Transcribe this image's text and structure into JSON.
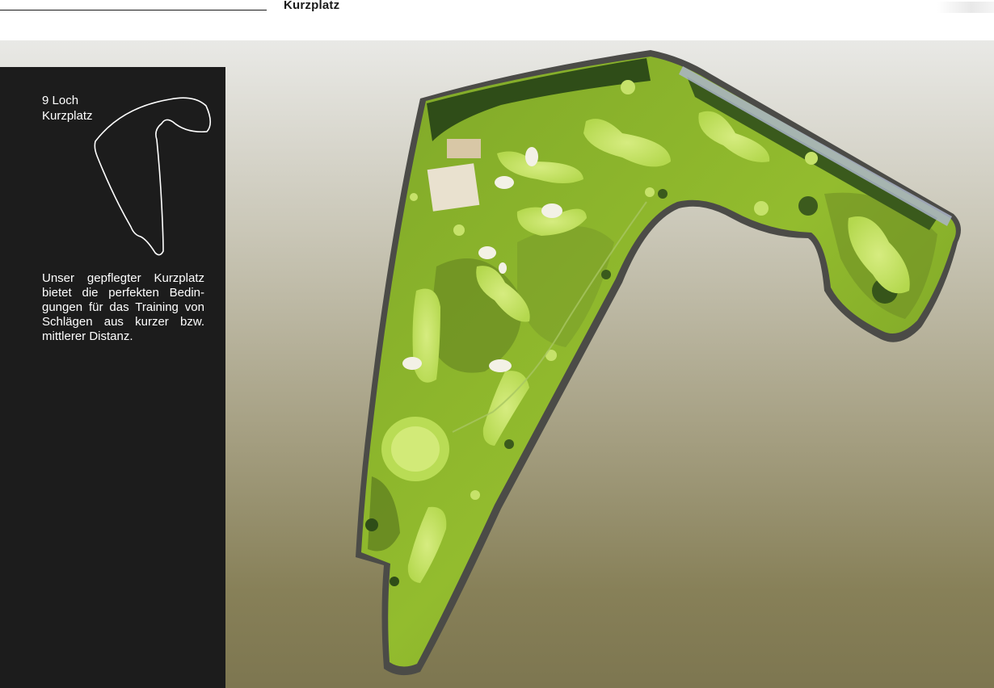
{
  "header": {
    "title": "Kurzplatz"
  },
  "panel": {
    "holes_line1": "9 Loch",
    "holes_line2": "Kurzplatz",
    "description": "Unser gepflegter Kurzplatz bietet die perfekten Bedin-gungen für das Training von Schlägen aus kurzer bzw. mittlerer Distanz."
  },
  "colors": {
    "panel_background": "#1c1c1c",
    "fairway": "#8fb82c",
    "green": "#c8e46a",
    "rough": "#6d8f25",
    "bunker": "#f3f1e6",
    "trees": "#2f4d18",
    "course_border": "#4a4a48"
  },
  "icons": {
    "course_outline": "course-outline-icon"
  }
}
